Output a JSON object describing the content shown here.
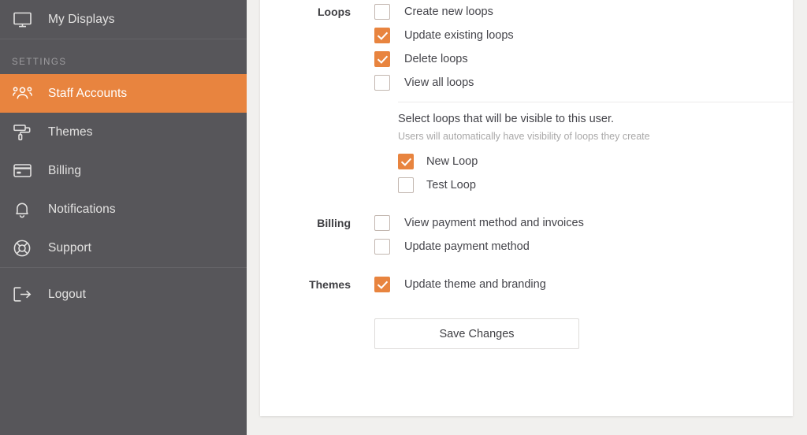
{
  "sidebar": {
    "top_items": [
      {
        "label": "My Displays",
        "icon": "monitor-icon",
        "key": "my-displays",
        "active": false
      }
    ],
    "section_heading": "SETTINGS",
    "settings_items": [
      {
        "label": "Staff Accounts",
        "icon": "people-group-icon",
        "key": "staff-accounts",
        "active": true
      },
      {
        "label": "Themes",
        "icon": "paint-roller-icon",
        "key": "themes",
        "active": false
      },
      {
        "label": "Billing",
        "icon": "credit-card-icon",
        "key": "billing",
        "active": false
      },
      {
        "label": "Notifications",
        "icon": "bell-icon",
        "key": "notifications",
        "active": false
      },
      {
        "label": "Support",
        "icon": "lifebuoy-icon",
        "key": "support",
        "active": false
      }
    ],
    "footer_items": [
      {
        "label": "Logout",
        "icon": "logout-arrow-icon",
        "key": "logout",
        "active": false
      }
    ],
    "colors": {
      "background": "#57565a",
      "active_background": "#e8843f",
      "text": "#e3e2e1",
      "heading_text": "#9e9da0",
      "divider": "#656468"
    }
  },
  "permissions_form": {
    "clipped_top_checkbox": {
      "checked": false
    },
    "groups": [
      {
        "label": "Loops",
        "key": "loops",
        "options": [
          {
            "label": "Create new loops",
            "checked": false
          },
          {
            "label": "Update existing loops",
            "checked": true
          },
          {
            "label": "Delete loops",
            "checked": true
          },
          {
            "label": "View all loops",
            "checked": false
          }
        ],
        "nested": {
          "title": "Select loops that will be visible to this user.",
          "subtitle": "Users will automatically have visibility of loops they create",
          "options": [
            {
              "label": "New Loop",
              "checked": true
            },
            {
              "label": "Test Loop",
              "checked": false
            }
          ]
        }
      },
      {
        "label": "Billing",
        "key": "billing",
        "options": [
          {
            "label": "View payment method and invoices",
            "checked": false
          },
          {
            "label": "Update payment method",
            "checked": false
          }
        ],
        "nested": null
      },
      {
        "label": "Themes",
        "key": "themes",
        "options": [
          {
            "label": "Update theme and branding",
            "checked": true
          }
        ],
        "nested": null
      }
    ],
    "save_label": "Save Changes",
    "colors": {
      "checkbox_checked": "#e8843f",
      "checkbox_border": "#c3b7b0",
      "label_text": "#3f3f43",
      "option_text": "#44444a",
      "subtitle_text": "#a9a8a8",
      "card_background": "#ffffff",
      "page_background": "#f1f0ee"
    }
  }
}
